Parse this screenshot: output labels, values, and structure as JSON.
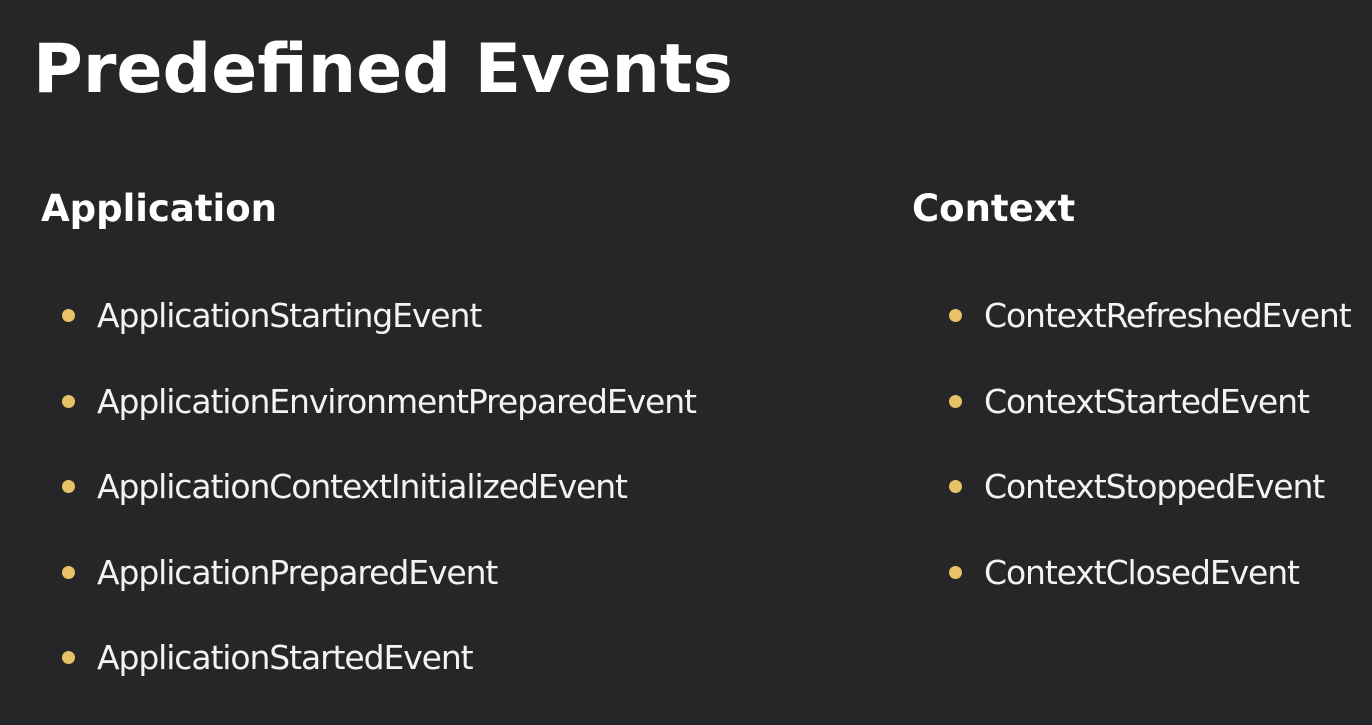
{
  "title": "Predefined Events",
  "colors": {
    "background": "#262527",
    "text": "#ffffff",
    "bullet": "#e7c266"
  },
  "application": {
    "heading": "Application",
    "items": [
      "ApplicationStartingEvent",
      "ApplicationEnvironmentPreparedEvent",
      "ApplicationContextInitializedEvent",
      "ApplicationPreparedEvent",
      "ApplicationStartedEvent"
    ]
  },
  "context": {
    "heading": "Context",
    "items": [
      "ContextRefreshedEvent",
      "ContextStartedEvent",
      "ContextStoppedEvent",
      "ContextClosedEvent"
    ]
  }
}
